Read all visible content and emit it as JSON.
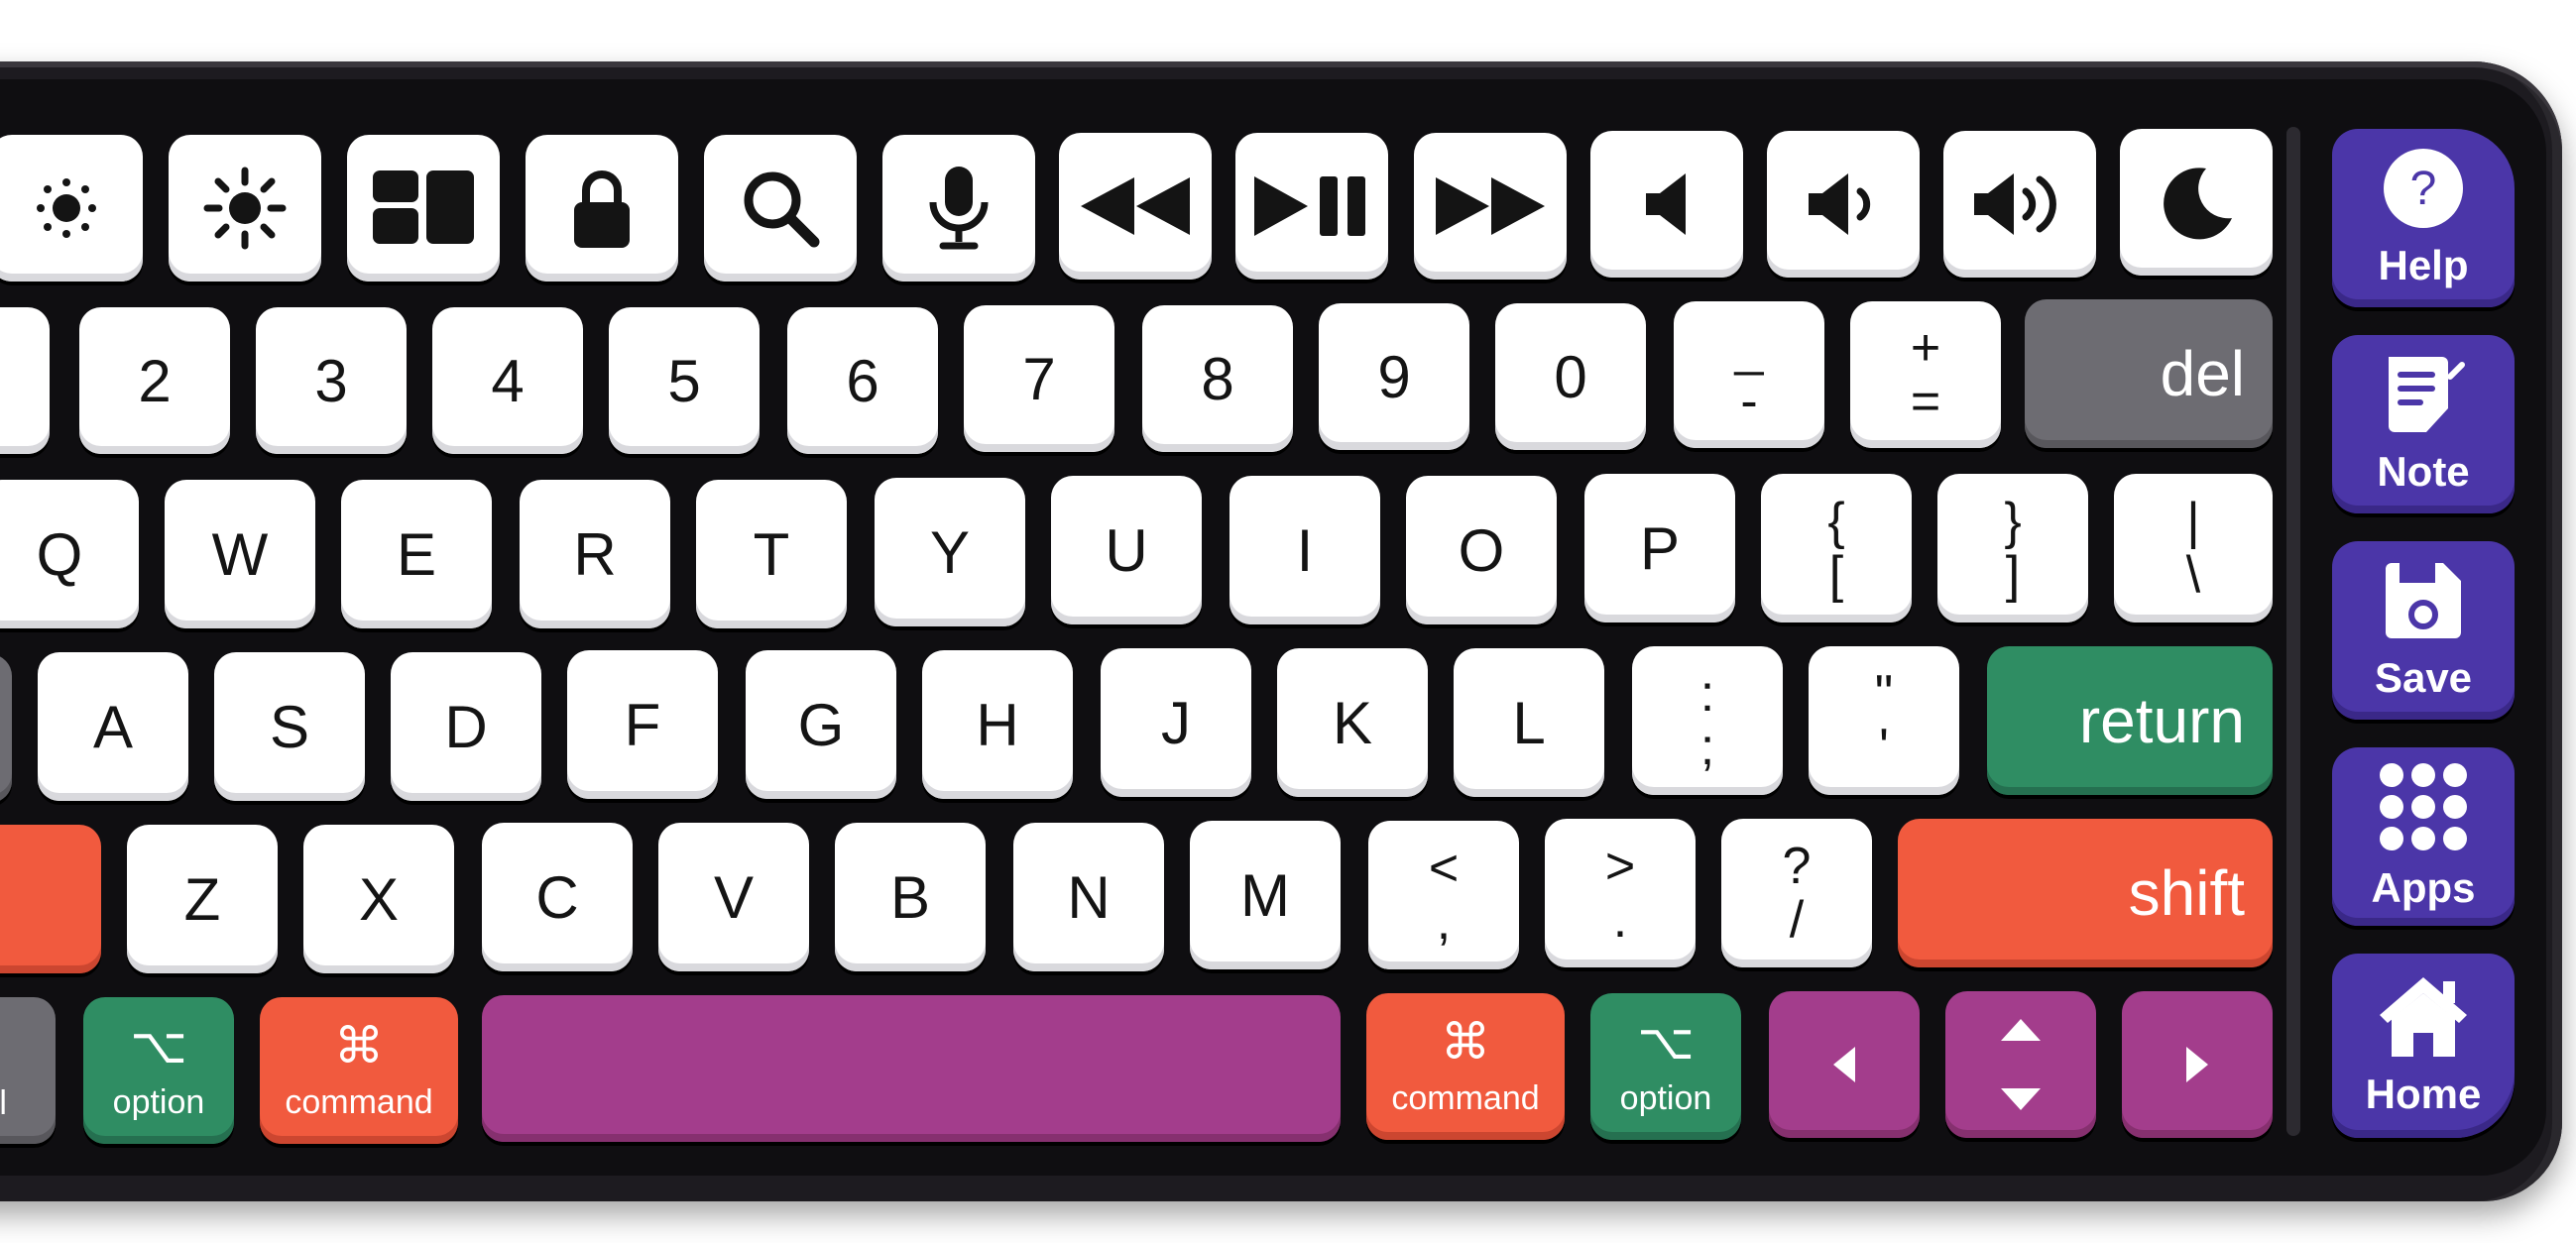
{
  "keyboard": {
    "number_row": [
      "2",
      "3",
      "4",
      "5",
      "6",
      "7",
      "8",
      "9",
      "0"
    ],
    "minus_key": {
      "top": "_",
      "bottom": "-"
    },
    "equals_key": {
      "top": "+",
      "bottom": "="
    },
    "del_label": "del",
    "qwerty_row": [
      "Q",
      "W",
      "E",
      "R",
      "T",
      "Y",
      "U",
      "I",
      "O",
      "P"
    ],
    "bracket_keys": [
      {
        "top": "{",
        "bottom": "["
      },
      {
        "top": "}",
        "bottom": "]"
      },
      {
        "top": "|",
        "bottom": "\\"
      }
    ],
    "home_row": [
      "A",
      "S",
      "D",
      "F",
      "G",
      "H",
      "J",
      "K",
      "L"
    ],
    "semicolon_key": {
      "top": ":",
      "bottom": ";"
    },
    "quote_key": {
      "top": "\"",
      "bottom": "'"
    },
    "return_label": "return",
    "bottom_letter_row": [
      "Z",
      "X",
      "C",
      "V",
      "B",
      "N",
      "M"
    ],
    "comma_key": {
      "top": "<",
      "bottom": ","
    },
    "period_key": {
      "top": ">",
      "bottom": "."
    },
    "slash_key": {
      "top": "?",
      "bottom": "/"
    },
    "shift_label": "shift",
    "control_label_partial": "rol",
    "option_symbol": "⌥",
    "option_label": "option",
    "command_symbol": "⌘",
    "command_label": "command"
  },
  "function_row_icons": [
    "brightness-down-icon",
    "brightness-up-icon",
    "mission-control-icon",
    "lock-icon",
    "search-icon",
    "microphone-icon",
    "rewind-icon",
    "play-pause-icon",
    "fast-forward-icon",
    "mute-icon",
    "volume-down-icon",
    "volume-up-icon",
    "sleep-moon-icon"
  ],
  "sidebar": {
    "items": [
      {
        "label": "Help",
        "icon": "help-icon"
      },
      {
        "label": "Note",
        "icon": "note-icon"
      },
      {
        "label": "Save",
        "icon": "save-icon"
      },
      {
        "label": "Apps",
        "icon": "apps-grid-icon"
      },
      {
        "label": "Home",
        "icon": "home-icon"
      }
    ]
  },
  "colors": {
    "board": "#1d1b20",
    "key_white": "#ffffff",
    "del_gray": "#6d6c72",
    "return_green": "#2f8d63",
    "shift_orange": "#f15a3e",
    "space_purple": "#a33d8c",
    "sidebar_indigo": "#4b36a8"
  }
}
